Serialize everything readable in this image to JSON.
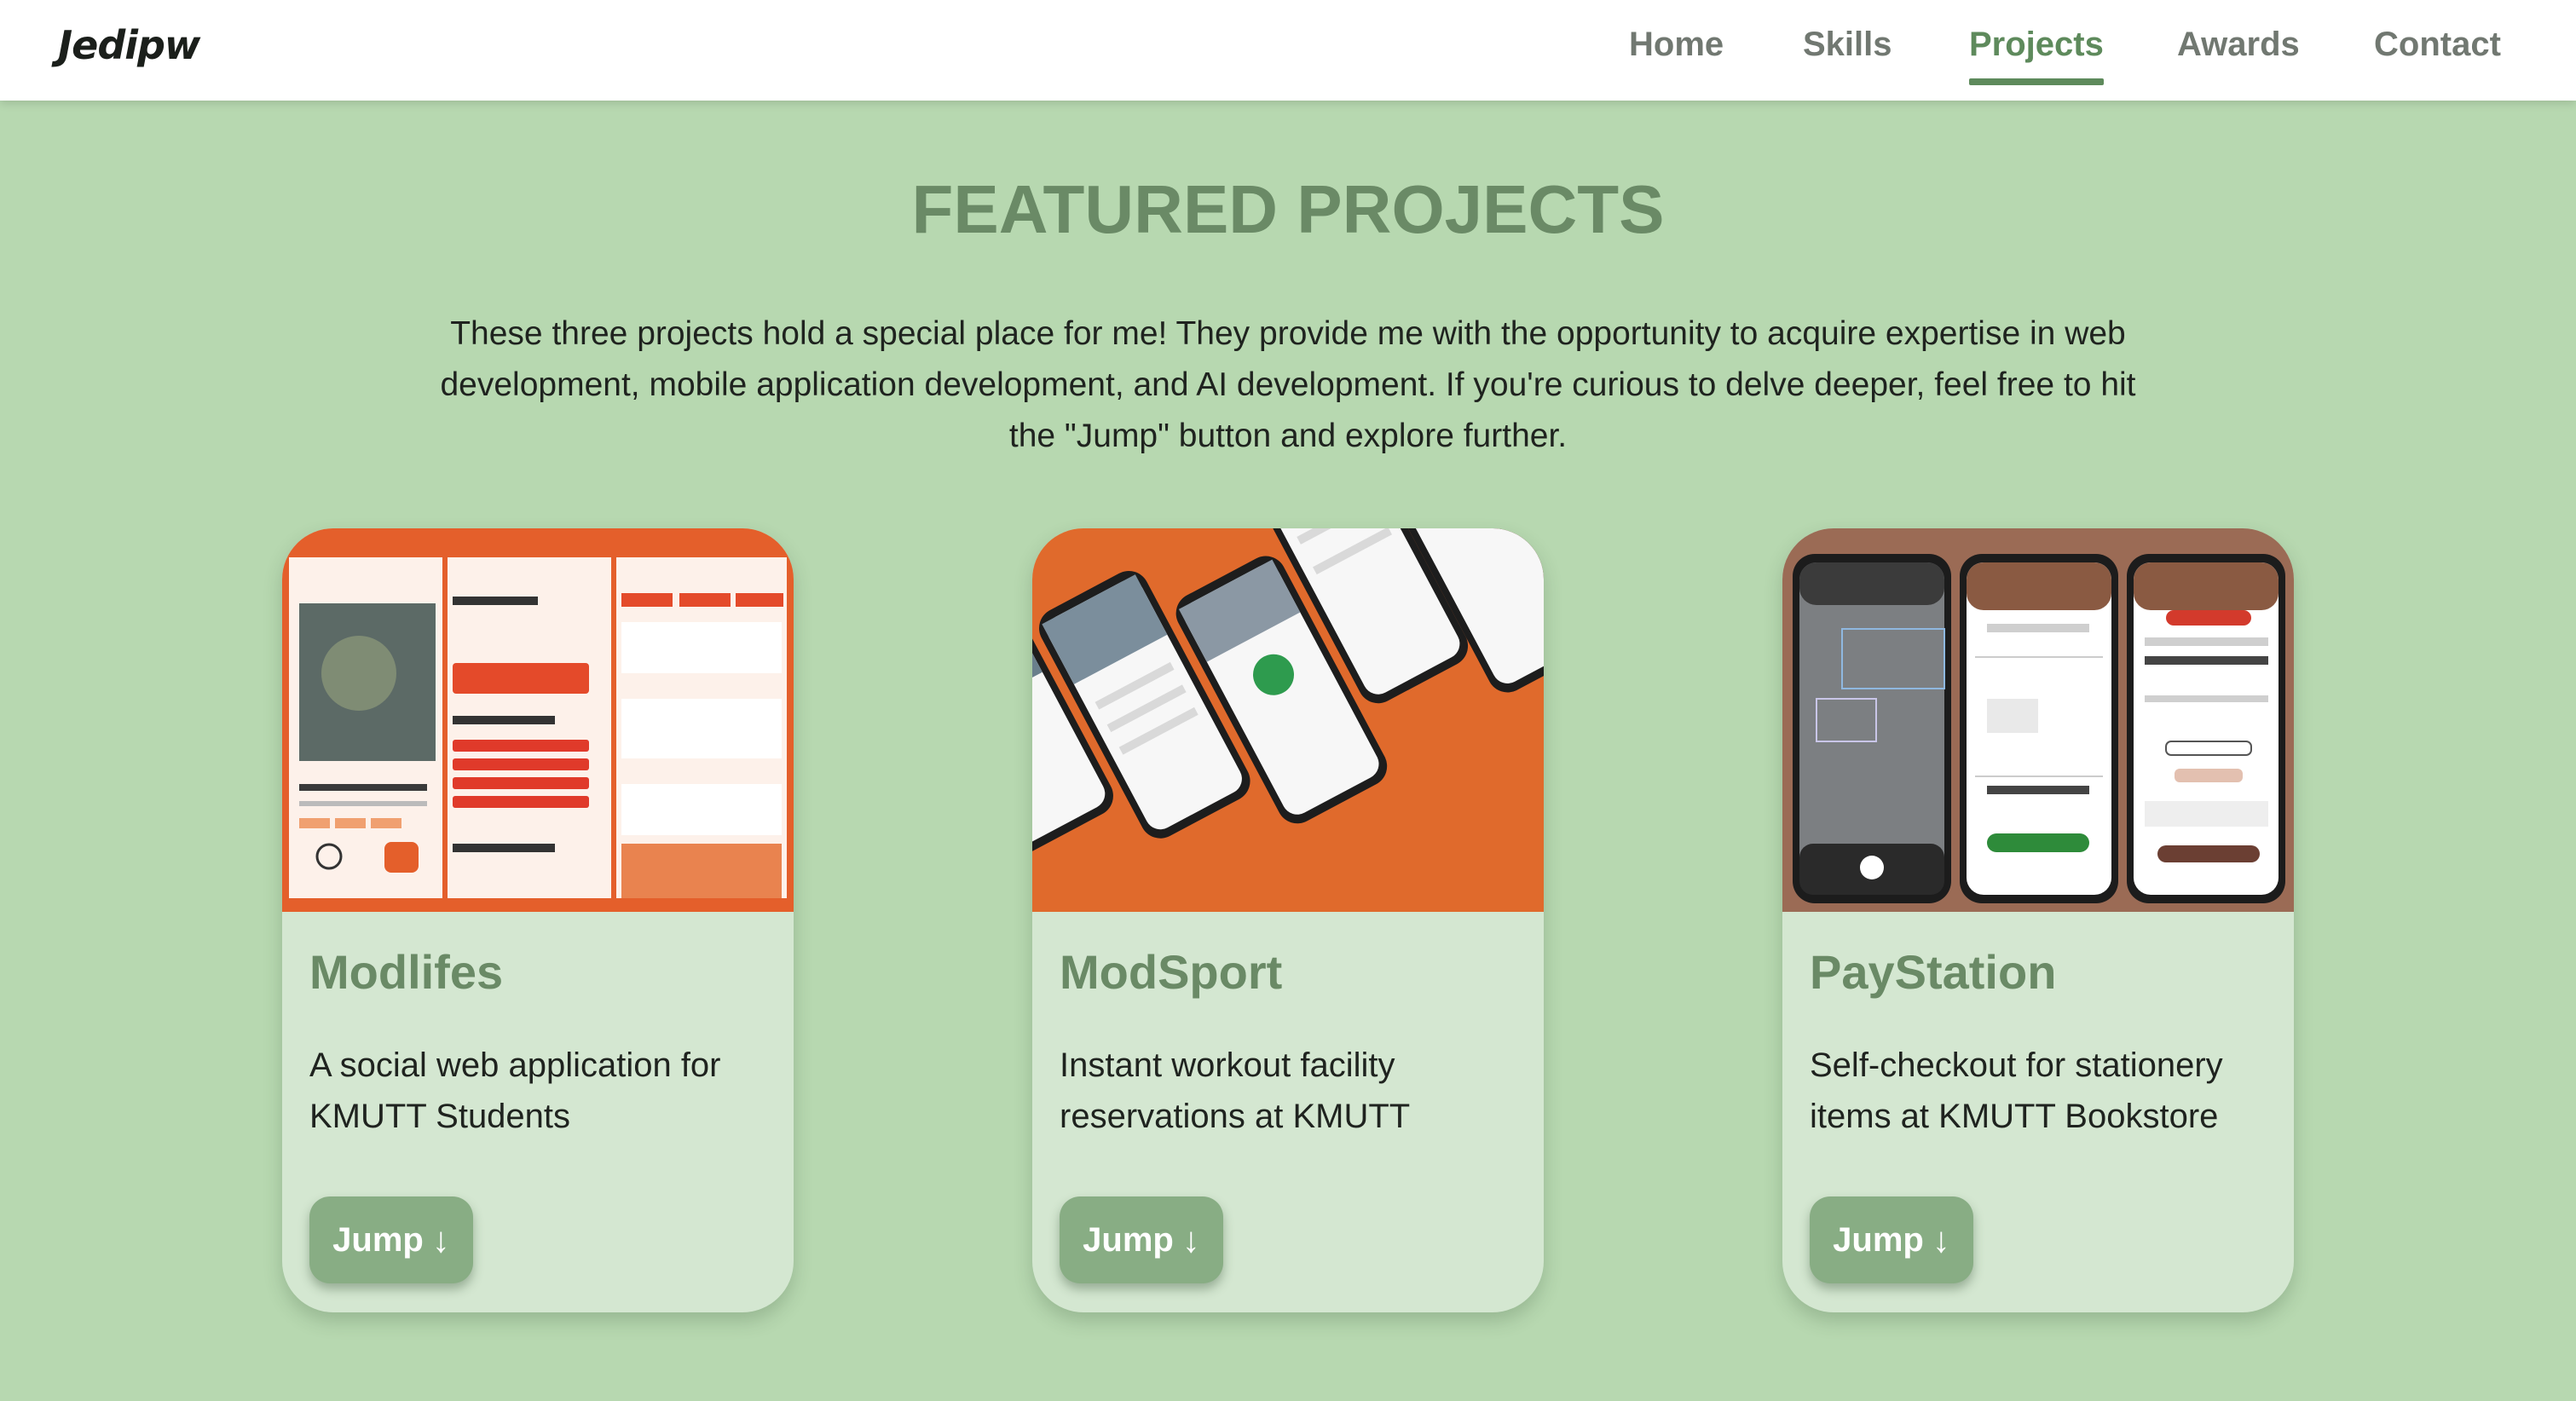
{
  "nav": {
    "logo": "Jedipw",
    "items": [
      {
        "label": "Home"
      },
      {
        "label": "Skills"
      },
      {
        "label": "Projects"
      },
      {
        "label": "Awards"
      },
      {
        "label": "Contact"
      }
    ],
    "active": "Projects"
  },
  "section": {
    "title": "FEATURED PROJECTS",
    "intro": "These three projects hold a special place for me! They provide me with the opportunity to acquire expertise in web development, mobile application development, and AI development. If you're curious to delve deeper, feel free to hit the \"Jump\" button and explore further."
  },
  "projects": [
    {
      "title": "Modlifes",
      "description": "A social web application for KMUTT Students",
      "button": "Jump",
      "button_icon": "arrow-down-icon",
      "media_color": "#e45f2b"
    },
    {
      "title": "ModSport",
      "description": "Instant workout facility reservations at KMUTT",
      "button": "Jump",
      "button_icon": "arrow-down-icon",
      "media_color": "#e06a2c"
    },
    {
      "title": "PayStation",
      "description": "Self-checkout for stationery items at KMUTT Bookstore",
      "button": "Jump",
      "button_icon": "arrow-down-icon",
      "media_color": "#9b6b55"
    }
  ],
  "colors": {
    "background": "#b7d8b0",
    "card": "#d4e7d1",
    "accent": "#6a8a66",
    "button": "#88ad84"
  }
}
